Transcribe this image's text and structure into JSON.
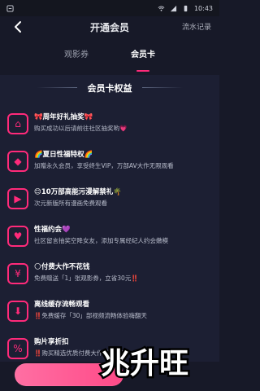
{
  "statusbar": {
    "time": "10:43",
    "icons": [
      "notification-icon",
      "wifi-icon",
      "signal-icon",
      "battery-icon"
    ]
  },
  "header": {
    "title": "开通会员",
    "right_link": "流水记录"
  },
  "tabs": [
    {
      "label": "观影券",
      "active": false
    },
    {
      "label": "会员卡",
      "active": true
    }
  ],
  "benefits": {
    "section_title": "会员卡权益",
    "items": [
      {
        "title": "🎀周年好礼抽奖🎀",
        "desc": "购买成功以后请前往社区抽奖哟💗",
        "icon": "gift-icon"
      },
      {
        "title": "🌈夏日性福特权🌈",
        "desc": "加赠永久会员，享受终生VIP，万部AV大作无限观看",
        "icon": "diamond-icon"
      },
      {
        "title": "😊10万部高能污漫解禁礼🌴",
        "desc": "次元新版所有漫画免费观看",
        "icon": "play-icon"
      },
      {
        "title": "性福约会💜",
        "desc": "社区留言抽奖空降女友，添加专属经纪人约会嫩模",
        "icon": "heart-icon"
      },
      {
        "title": "🌕付费大作不花钱",
        "desc": "免费赠送「1」张观影券，立省30元‼️",
        "icon": "coin-icon"
      },
      {
        "title": "离线缓存流畅观看",
        "desc": "‼️免费缓存「30」部视频流畅体验嗨翻天",
        "icon": "download-icon"
      },
      {
        "title": "购片享折扣",
        "desc": "‼️购买精选优质付费大作8折优惠",
        "icon": "tag-icon"
      }
    ]
  },
  "footer": {
    "buy_button_label": "",
    "watermark_text": "兆升旺"
  },
  "colors": {
    "accent": "#ff2a7a",
    "background": "#171928",
    "card": "#1c1f33"
  }
}
